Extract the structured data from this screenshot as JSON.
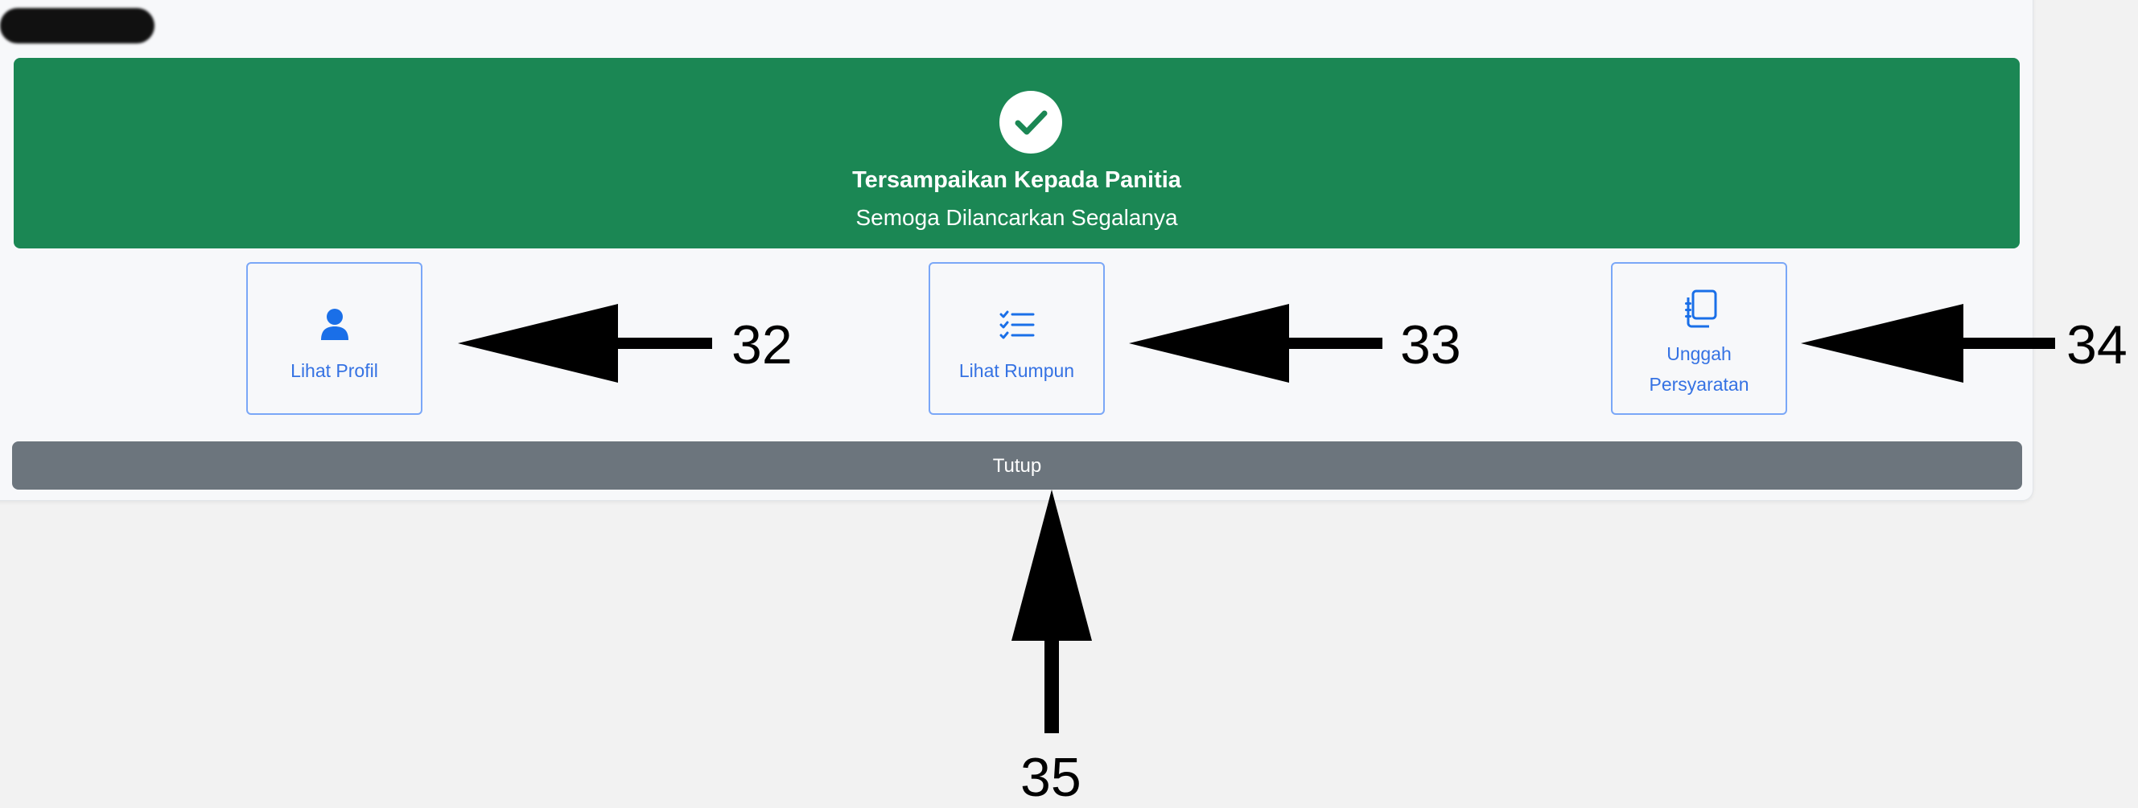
{
  "banner": {
    "title": "Tersampaikan Kepada Panitia",
    "subtitle": "Semoga Dilancarkan Segalanya",
    "icon": "check-circle-icon",
    "color": "#1b8754"
  },
  "actions": {
    "profil": {
      "label": "Lihat Profil",
      "icon": "user-icon"
    },
    "rumpun": {
      "label": "Lihat Rumpun",
      "icon": "list-check-icon"
    },
    "syarat": {
      "label": "Unggah Persyaratan",
      "line1": "Unggah",
      "line2": "Persyaratan",
      "icon": "journal-icon"
    }
  },
  "close_button": {
    "label": "Tutup",
    "color": "#6c757d"
  },
  "callouts": [
    "32",
    "33",
    "34",
    "35"
  ]
}
